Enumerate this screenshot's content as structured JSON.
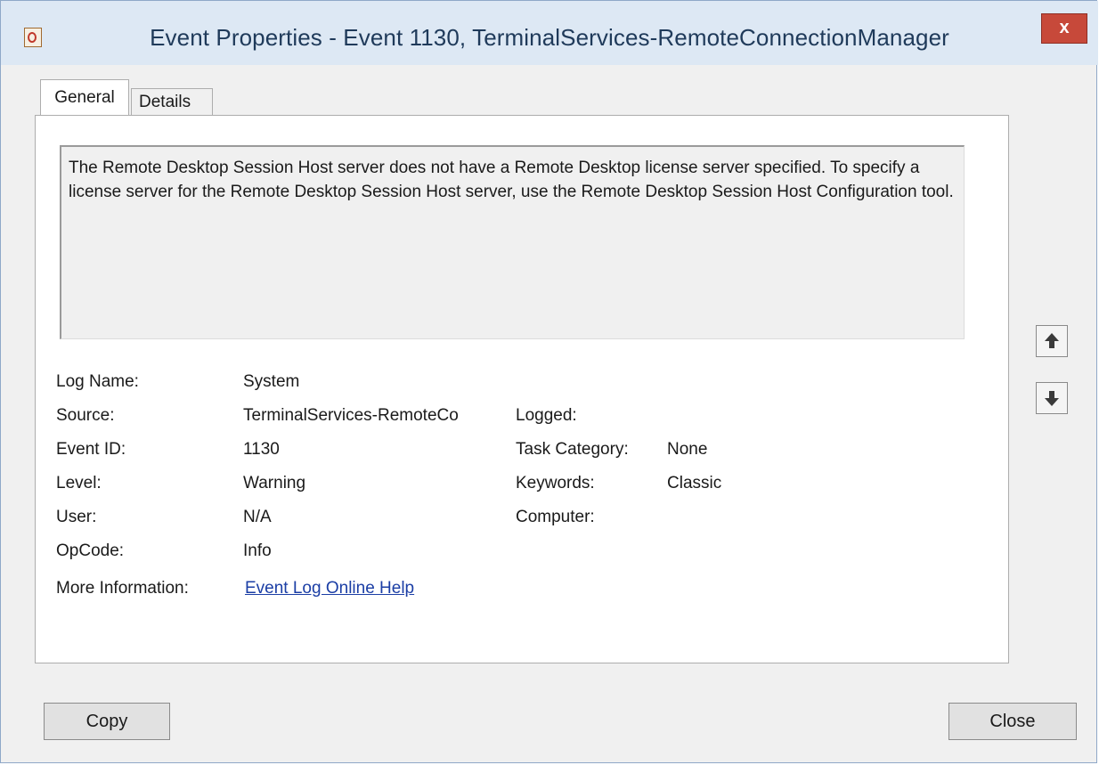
{
  "window": {
    "title": "Event Properties - Event 1130, TerminalServices-RemoteConnectionManager",
    "close_label": "x"
  },
  "tabs": [
    {
      "label": "General",
      "active": true
    },
    {
      "label": "Details",
      "active": false
    }
  ],
  "description": "The Remote Desktop Session Host server does not have a Remote Desktop license server specified. To specify a license server for the Remote Desktop Session Host server, use the Remote Desktop Session Host Configuration tool.",
  "fields": {
    "log_name": {
      "label": "Log Name:",
      "value": "System"
    },
    "source": {
      "label": "Source:",
      "value": "TerminalServices-RemoteCo"
    },
    "event_id": {
      "label": "Event ID:",
      "value": "1130"
    },
    "level": {
      "label": "Level:",
      "value": "Warning"
    },
    "user": {
      "label": "User:",
      "value": "N/A"
    },
    "opcode": {
      "label": "OpCode:",
      "value": "Info"
    },
    "more_information": {
      "label": "More Information:",
      "value": "Event Log Online Help"
    },
    "logged": {
      "label": "Logged:",
      "value": ""
    },
    "task_category": {
      "label": "Task Category:",
      "value": "None"
    },
    "keywords": {
      "label": "Keywords:",
      "value": "Classic"
    },
    "computer": {
      "label": "Computer:",
      "value": ""
    }
  },
  "buttons": {
    "copy": "Copy",
    "close": "Close"
  },
  "icons": {
    "app": "event-viewer-icon",
    "up": "arrow-up-icon",
    "down": "arrow-down-icon"
  },
  "colors": {
    "title_bar": "#dde8f4",
    "close_button": "#c7493a",
    "link": "#1b3ea5"
  }
}
